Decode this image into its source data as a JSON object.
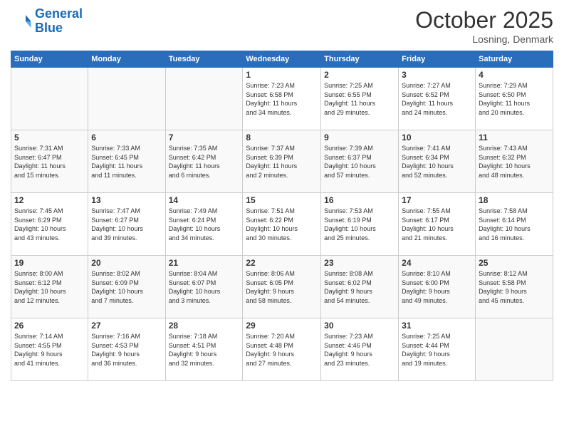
{
  "header": {
    "logo_line1": "General",
    "logo_line2": "Blue",
    "month": "October 2025",
    "location": "Losning, Denmark"
  },
  "weekdays": [
    "Sunday",
    "Monday",
    "Tuesday",
    "Wednesday",
    "Thursday",
    "Friday",
    "Saturday"
  ],
  "weeks": [
    [
      {
        "day": "",
        "info": ""
      },
      {
        "day": "",
        "info": ""
      },
      {
        "day": "",
        "info": ""
      },
      {
        "day": "1",
        "info": "Sunrise: 7:23 AM\nSunset: 6:58 PM\nDaylight: 11 hours\nand 34 minutes."
      },
      {
        "day": "2",
        "info": "Sunrise: 7:25 AM\nSunset: 6:55 PM\nDaylight: 11 hours\nand 29 minutes."
      },
      {
        "day": "3",
        "info": "Sunrise: 7:27 AM\nSunset: 6:52 PM\nDaylight: 11 hours\nand 24 minutes."
      },
      {
        "day": "4",
        "info": "Sunrise: 7:29 AM\nSunset: 6:50 PM\nDaylight: 11 hours\nand 20 minutes."
      }
    ],
    [
      {
        "day": "5",
        "info": "Sunrise: 7:31 AM\nSunset: 6:47 PM\nDaylight: 11 hours\nand 15 minutes."
      },
      {
        "day": "6",
        "info": "Sunrise: 7:33 AM\nSunset: 6:45 PM\nDaylight: 11 hours\nand 11 minutes."
      },
      {
        "day": "7",
        "info": "Sunrise: 7:35 AM\nSunset: 6:42 PM\nDaylight: 11 hours\nand 6 minutes."
      },
      {
        "day": "8",
        "info": "Sunrise: 7:37 AM\nSunset: 6:39 PM\nDaylight: 11 hours\nand 2 minutes."
      },
      {
        "day": "9",
        "info": "Sunrise: 7:39 AM\nSunset: 6:37 PM\nDaylight: 10 hours\nand 57 minutes."
      },
      {
        "day": "10",
        "info": "Sunrise: 7:41 AM\nSunset: 6:34 PM\nDaylight: 10 hours\nand 52 minutes."
      },
      {
        "day": "11",
        "info": "Sunrise: 7:43 AM\nSunset: 6:32 PM\nDaylight: 10 hours\nand 48 minutes."
      }
    ],
    [
      {
        "day": "12",
        "info": "Sunrise: 7:45 AM\nSunset: 6:29 PM\nDaylight: 10 hours\nand 43 minutes."
      },
      {
        "day": "13",
        "info": "Sunrise: 7:47 AM\nSunset: 6:27 PM\nDaylight: 10 hours\nand 39 minutes."
      },
      {
        "day": "14",
        "info": "Sunrise: 7:49 AM\nSunset: 6:24 PM\nDaylight: 10 hours\nand 34 minutes."
      },
      {
        "day": "15",
        "info": "Sunrise: 7:51 AM\nSunset: 6:22 PM\nDaylight: 10 hours\nand 30 minutes."
      },
      {
        "day": "16",
        "info": "Sunrise: 7:53 AM\nSunset: 6:19 PM\nDaylight: 10 hours\nand 25 minutes."
      },
      {
        "day": "17",
        "info": "Sunrise: 7:55 AM\nSunset: 6:17 PM\nDaylight: 10 hours\nand 21 minutes."
      },
      {
        "day": "18",
        "info": "Sunrise: 7:58 AM\nSunset: 6:14 PM\nDaylight: 10 hours\nand 16 minutes."
      }
    ],
    [
      {
        "day": "19",
        "info": "Sunrise: 8:00 AM\nSunset: 6:12 PM\nDaylight: 10 hours\nand 12 minutes."
      },
      {
        "day": "20",
        "info": "Sunrise: 8:02 AM\nSunset: 6:09 PM\nDaylight: 10 hours\nand 7 minutes."
      },
      {
        "day": "21",
        "info": "Sunrise: 8:04 AM\nSunset: 6:07 PM\nDaylight: 10 hours\nand 3 minutes."
      },
      {
        "day": "22",
        "info": "Sunrise: 8:06 AM\nSunset: 6:05 PM\nDaylight: 9 hours\nand 58 minutes."
      },
      {
        "day": "23",
        "info": "Sunrise: 8:08 AM\nSunset: 6:02 PM\nDaylight: 9 hours\nand 54 minutes."
      },
      {
        "day": "24",
        "info": "Sunrise: 8:10 AM\nSunset: 6:00 PM\nDaylight: 9 hours\nand 49 minutes."
      },
      {
        "day": "25",
        "info": "Sunrise: 8:12 AM\nSunset: 5:58 PM\nDaylight: 9 hours\nand 45 minutes."
      }
    ],
    [
      {
        "day": "26",
        "info": "Sunrise: 7:14 AM\nSunset: 4:55 PM\nDaylight: 9 hours\nand 41 minutes."
      },
      {
        "day": "27",
        "info": "Sunrise: 7:16 AM\nSunset: 4:53 PM\nDaylight: 9 hours\nand 36 minutes."
      },
      {
        "day": "28",
        "info": "Sunrise: 7:18 AM\nSunset: 4:51 PM\nDaylight: 9 hours\nand 32 minutes."
      },
      {
        "day": "29",
        "info": "Sunrise: 7:20 AM\nSunset: 4:48 PM\nDaylight: 9 hours\nand 27 minutes."
      },
      {
        "day": "30",
        "info": "Sunrise: 7:23 AM\nSunset: 4:46 PM\nDaylight: 9 hours\nand 23 minutes."
      },
      {
        "day": "31",
        "info": "Sunrise: 7:25 AM\nSunset: 4:44 PM\nDaylight: 9 hours\nand 19 minutes."
      },
      {
        "day": "",
        "info": ""
      }
    ]
  ]
}
